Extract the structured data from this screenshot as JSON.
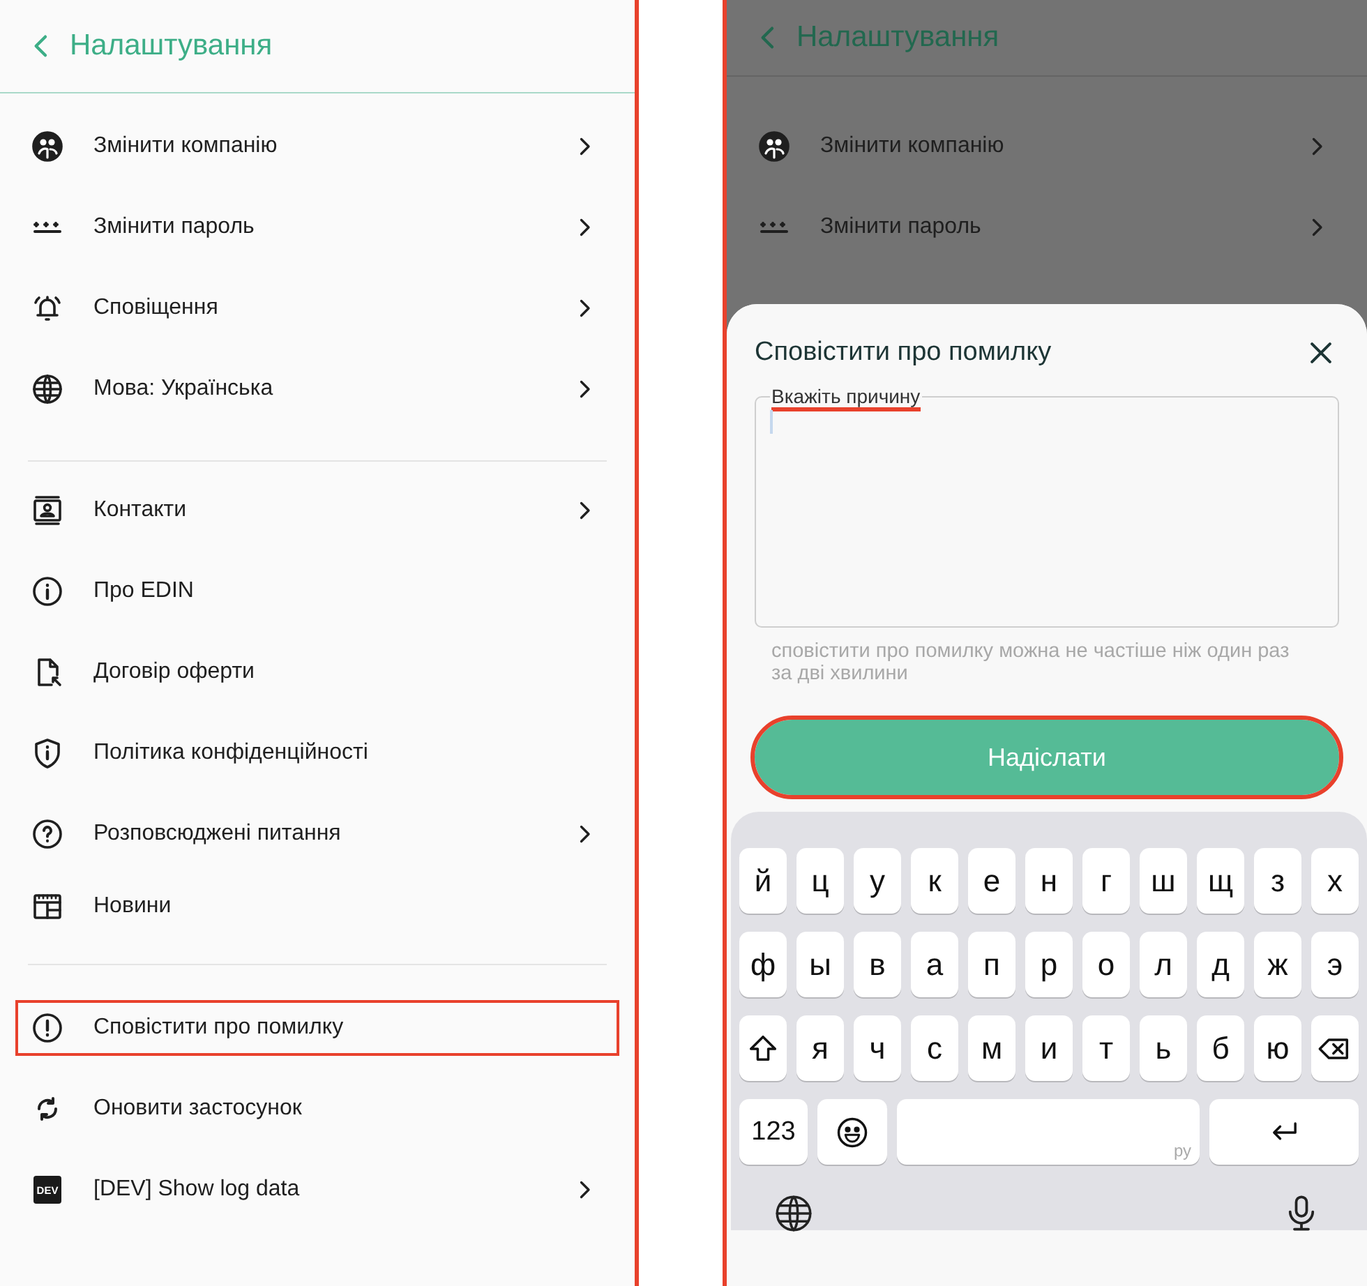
{
  "settings_screen": {
    "header": {
      "title": "Налаштування"
    },
    "sections": [
      {
        "items": [
          {
            "label": "Змінити компанію",
            "chevron": true,
            "highlighted": false
          },
          {
            "label": "Змінити пароль",
            "chevron": true,
            "highlighted": false
          },
          {
            "label": "Сповіщення",
            "chevron": true,
            "highlighted": false
          },
          {
            "label": "Мова: Українська",
            "chevron": true,
            "highlighted": false
          }
        ]
      },
      {
        "items": [
          {
            "label": "Контакти",
            "chevron": true,
            "highlighted": false
          },
          {
            "label": "Про EDIN",
            "chevron": false,
            "highlighted": false
          },
          {
            "label": "Договір оферти",
            "chevron": false,
            "highlighted": false
          },
          {
            "label": "Політика конфіденційності",
            "chevron": false,
            "highlighted": false
          },
          {
            "label": "Розповсюджені питання",
            "chevron": true,
            "highlighted": false
          },
          {
            "label": "Новини",
            "chevron": false,
            "highlighted": false
          }
        ]
      },
      {
        "items": [
          {
            "label": "Сповістити про помилку",
            "chevron": false,
            "highlighted": true
          },
          {
            "label": "Оновити застосунок",
            "chevron": false,
            "highlighted": false
          },
          {
            "label": "[DEV] Show log data",
            "badge": "DEV",
            "chevron": true,
            "highlighted": false
          }
        ]
      }
    ]
  },
  "report_screen": {
    "background": {
      "title": "Налаштування",
      "items": [
        {
          "label": "Змінити компанію",
          "chevron": true
        },
        {
          "label": "Змінити пароль",
          "chevron": true
        }
      ]
    },
    "sheet": {
      "title": "Сповістити про помилку",
      "field": {
        "label": "Вкажіть причину",
        "highlighted": true
      },
      "hint": "сповістити про помилку можна не частіше ніж один раз за дві хвилини",
      "send_button": {
        "label": "Надіслати",
        "highlighted": true
      }
    },
    "keyboard": {
      "rows": [
        [
          {
            "kind": "letter",
            "label": "й"
          },
          {
            "kind": "letter",
            "label": "ц"
          },
          {
            "kind": "letter",
            "label": "у"
          },
          {
            "kind": "letter",
            "label": "к"
          },
          {
            "kind": "letter",
            "label": "е"
          },
          {
            "kind": "letter",
            "label": "н"
          },
          {
            "kind": "letter",
            "label": "г"
          },
          {
            "kind": "letter",
            "label": "ш"
          },
          {
            "kind": "letter",
            "label": "щ"
          },
          {
            "kind": "letter",
            "label": "з"
          },
          {
            "kind": "letter",
            "label": "х"
          }
        ],
        [
          {
            "kind": "letter",
            "label": "ф"
          },
          {
            "kind": "letter",
            "label": "ы"
          },
          {
            "kind": "letter",
            "label": "в"
          },
          {
            "kind": "letter",
            "label": "а"
          },
          {
            "kind": "letter",
            "label": "п"
          },
          {
            "kind": "letter",
            "label": "р"
          },
          {
            "kind": "letter",
            "label": "о"
          },
          {
            "kind": "letter",
            "label": "л"
          },
          {
            "kind": "letter",
            "label": "д"
          },
          {
            "kind": "letter",
            "label": "ж"
          },
          {
            "kind": "letter",
            "label": "э"
          }
        ],
        [
          {
            "kind": "shift"
          },
          {
            "kind": "letter",
            "label": "я"
          },
          {
            "kind": "letter",
            "label": "ч"
          },
          {
            "kind": "letter",
            "label": "с"
          },
          {
            "kind": "letter",
            "label": "м"
          },
          {
            "kind": "letter",
            "label": "и"
          },
          {
            "kind": "letter",
            "label": "т"
          },
          {
            "kind": "letter",
            "label": "ь"
          },
          {
            "kind": "letter",
            "label": "б"
          },
          {
            "kind": "letter",
            "label": "ю"
          },
          {
            "kind": "backspace"
          }
        ]
      ],
      "numbers_key": "123",
      "space_hint": "ру"
    }
  }
}
